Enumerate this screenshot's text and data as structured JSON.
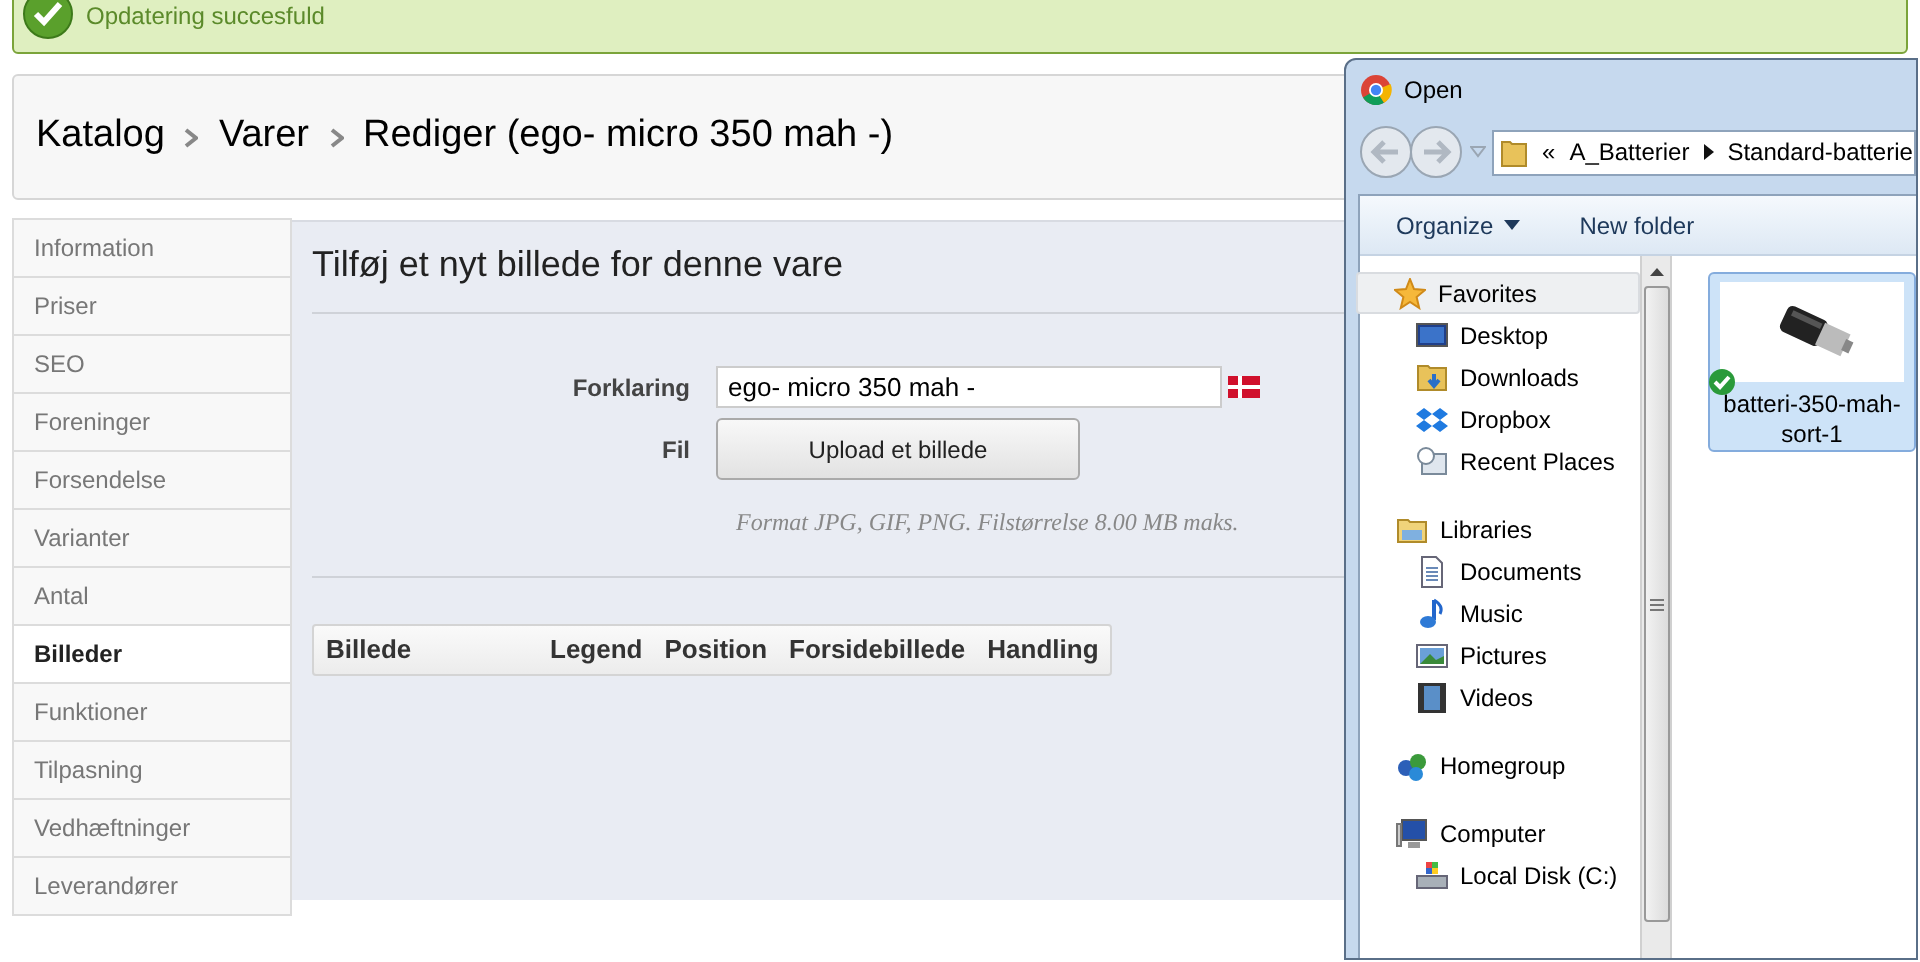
{
  "notice": {
    "text": "Opdatering succesfuld"
  },
  "breadcrumb": [
    "Katalog",
    "Varer",
    "Rediger (ego- micro 350 mah -)"
  ],
  "sidebar": {
    "items": [
      {
        "label": "Information",
        "selected": false
      },
      {
        "label": "Priser",
        "selected": false
      },
      {
        "label": "SEO",
        "selected": false
      },
      {
        "label": "Foreninger",
        "selected": false
      },
      {
        "label": "Forsendelse",
        "selected": false
      },
      {
        "label": "Varianter",
        "selected": false
      },
      {
        "label": "Antal",
        "selected": false
      },
      {
        "label": "Billeder",
        "selected": true
      },
      {
        "label": "Funktioner",
        "selected": false
      },
      {
        "label": "Tilpasning",
        "selected": false
      },
      {
        "label": "Vedhæftninger",
        "selected": false
      },
      {
        "label": "Leverandører",
        "selected": false
      }
    ]
  },
  "panel": {
    "title": "Tilføj et nyt billede for denne vare",
    "caption_label": "Forklaring",
    "caption_value": "ego- micro 350 mah -",
    "file_label": "Fil",
    "upload_button": "Upload et billede",
    "hint": "Format JPG, GIF, PNG. Filstørrelse 8.00 MB maks.",
    "table": {
      "columns": [
        "Billede",
        "Legend",
        "Position",
        "Forsidebillede",
        "Handling"
      ]
    }
  },
  "dialog": {
    "title": "Open",
    "path": [
      "«",
      "A_Batterier",
      "Standard-batterie"
    ],
    "toolbar": [
      "Organize",
      "New folder"
    ],
    "nav": [
      {
        "label": "Favorites",
        "kind": "star",
        "header": true,
        "selected": true
      },
      {
        "label": "Desktop",
        "kind": "desktop",
        "header": false,
        "selected": false
      },
      {
        "label": "Downloads",
        "kind": "downloads",
        "header": false,
        "selected": false
      },
      {
        "label": "Dropbox",
        "kind": "dropbox",
        "header": false,
        "selected": false
      },
      {
        "label": "Recent Places",
        "kind": "recent",
        "header": false,
        "selected": false
      },
      {
        "label": "Libraries",
        "kind": "folder",
        "header": true,
        "selected": false
      },
      {
        "label": "Documents",
        "kind": "document",
        "header": false,
        "selected": false
      },
      {
        "label": "Music",
        "kind": "music",
        "header": false,
        "selected": false
      },
      {
        "label": "Pictures",
        "kind": "pictures",
        "header": false,
        "selected": false
      },
      {
        "label": "Videos",
        "kind": "videos",
        "header": false,
        "selected": false
      },
      {
        "label": "Homegroup",
        "kind": "homegroup",
        "header": true,
        "selected": false
      },
      {
        "label": "Computer",
        "kind": "computer",
        "header": true,
        "selected": false
      },
      {
        "label": "Local Disk (C:)",
        "kind": "disk",
        "header": false,
        "selected": false
      }
    ],
    "files": [
      {
        "name": "batteri-350-mah-sort-1",
        "selected": true,
        "synced": true
      }
    ]
  }
}
